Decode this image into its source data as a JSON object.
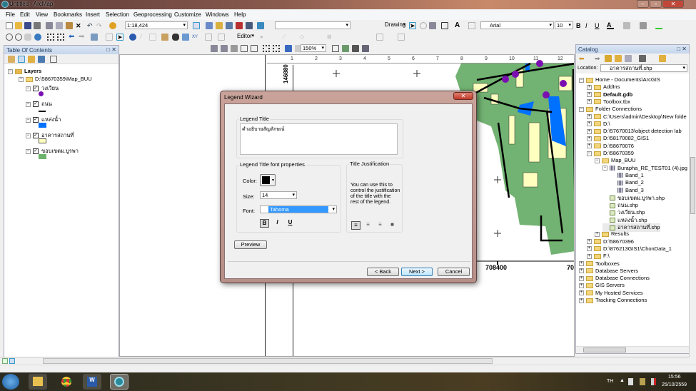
{
  "window": {
    "title": "Untitled - ArcMap",
    "min": "–",
    "max": "▫",
    "close": "✕"
  },
  "menu": [
    "File",
    "Edit",
    "View",
    "Bookmarks",
    "Insert",
    "Selection",
    "Geoprocessing",
    "Customize",
    "Windows",
    "Help"
  ],
  "toolbar": {
    "scale": "1:18,424",
    "drawing": "Drawing",
    "font": "Arial",
    "font_size": "10",
    "bold": "B",
    "italic": "I",
    "underline": "U",
    "editor": "Editor",
    "zoom": "150%",
    "text_tool": "A"
  },
  "toc": {
    "title": "Table Of Contents",
    "root": "Layers",
    "group": "D:\\58670359\\Map_BUU",
    "layers": [
      {
        "name": "วงเวียน",
        "color": "#7a10b0"
      },
      {
        "name": "ถนน",
        "color": "#000000"
      },
      {
        "name": "แหล่งน้ำ",
        "color": "#0070ff"
      },
      {
        "name": "อาคารสถานที่",
        "color": "#ffffc0"
      },
      {
        "name": "ขอบเขตม.บูรพา",
        "color": "#6cb36c"
      }
    ]
  },
  "map": {
    "y_label": "146880",
    "x_labels": [
      "708400",
      "70"
    ],
    "ruler": [
      "1",
      "2",
      "3",
      "4",
      "5",
      "6",
      "7",
      "8",
      "9",
      "10",
      "11",
      "12"
    ]
  },
  "catalog": {
    "title": "Catalog",
    "location_label": "Location:",
    "location_value": "อาคารสถานที่.shp",
    "items": [
      {
        "label": "Home - Documents\\ArcGIS",
        "lvl": 0,
        "pm": "−"
      },
      {
        "label": "AddIns",
        "lvl": 1,
        "pm": "+"
      },
      {
        "label": "Default.gdb",
        "lvl": 1,
        "pm": "+",
        "bold": true
      },
      {
        "label": "Toolbox.tbx",
        "lvl": 1,
        "pm": "+"
      },
      {
        "label": "Folder Connections",
        "lvl": 0,
        "pm": "−"
      },
      {
        "label": "C:\\Users\\admin\\Desktop\\New folde",
        "lvl": 1,
        "pm": "+"
      },
      {
        "label": "D:\\",
        "lvl": 1,
        "pm": "+"
      },
      {
        "label": "D:\\57670013\\object detection lab",
        "lvl": 1,
        "pm": "+"
      },
      {
        "label": "D:\\58170082_GIS1",
        "lvl": 1,
        "pm": "+"
      },
      {
        "label": "D:\\58670076",
        "lvl": 1,
        "pm": "+"
      },
      {
        "label": "D:\\58670359",
        "lvl": 1,
        "pm": "−"
      },
      {
        "label": "Map_BUU",
        "lvl": 2,
        "pm": "−"
      },
      {
        "label": "Burapha_RE_TEST01 (4).jpg",
        "lvl": 3,
        "pm": "−",
        "raster": true
      },
      {
        "label": "Band_1",
        "lvl": 4,
        "raster": true
      },
      {
        "label": "Band_2",
        "lvl": 4,
        "raster": true
      },
      {
        "label": "Band_3",
        "lvl": 4,
        "raster": true
      },
      {
        "label": "ขอบเขตม.บูรพา.shp",
        "lvl": 3,
        "shp": true
      },
      {
        "label": "ถนน.shp",
        "lvl": 3,
        "shp": true
      },
      {
        "label": "วงเวียน.shp",
        "lvl": 3,
        "shp": true
      },
      {
        "label": "แหล่งน้ำ.shp",
        "lvl": 3,
        "shp": true
      },
      {
        "label": "อาคารสถานที่.shp",
        "lvl": 3,
        "shp": true,
        "selected": true
      },
      {
        "label": "Results",
        "lvl": 2,
        "pm": "+"
      },
      {
        "label": "D:\\58670396",
        "lvl": 1,
        "pm": "+"
      },
      {
        "label": "D:\\876213GIS1\\ChonData_1",
        "lvl": 1,
        "pm": "+"
      },
      {
        "label": "F:\\",
        "lvl": 1,
        "pm": "+"
      },
      {
        "label": "Toolboxes",
        "lvl": 0,
        "pm": "+"
      },
      {
        "label": "Database Servers",
        "lvl": 0,
        "pm": "+"
      },
      {
        "label": "Database Connections",
        "lvl": 0,
        "pm": "+"
      },
      {
        "label": "GIS Servers",
        "lvl": 0,
        "pm": "+"
      },
      {
        "label": "My Hosted Services",
        "lvl": 0,
        "pm": "+"
      },
      {
        "label": "Tracking Connections",
        "lvl": 0,
        "pm": "+"
      }
    ]
  },
  "dialog": {
    "title": "Legend Wizard",
    "legend_title_label": "Legend Title",
    "legend_title_value": "คำอธิบายสัญลักษณ์",
    "font_props_label": "Legend Title font properties",
    "color_label": "Color:",
    "color_value": "#000000",
    "size_label": "Size:",
    "size_value": "14",
    "font_label": "Font:",
    "font_value": "Tahoma",
    "bold": "B",
    "italic": "I",
    "underline": "U",
    "justification_label": "Title Justification",
    "justification_help": "You can use this to control the justification of the title with the rest of the legend.",
    "preview": "Preview",
    "back": "< Back",
    "next": "Next >",
    "cancel": "Cancel"
  },
  "taskbar": {
    "lang": "TH",
    "time": "15:56",
    "date": "25/10/2559"
  }
}
